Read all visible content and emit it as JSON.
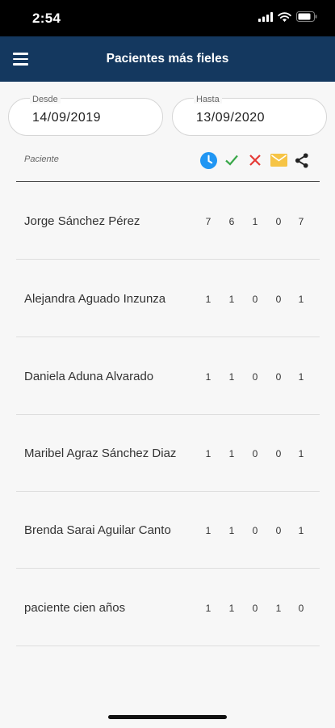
{
  "status_bar": {
    "time": "2:54"
  },
  "app_bar": {
    "title": "Pacientes más fieles"
  },
  "filters": {
    "desde": {
      "label": "Desde",
      "value": "14/09/2019"
    },
    "hasta": {
      "label": "Hasta",
      "value": "13/09/2020"
    }
  },
  "table": {
    "column_label": "Paciente",
    "icons": [
      "clock-icon",
      "check-icon",
      "cross-icon",
      "mail-icon",
      "share-icon"
    ],
    "colors": {
      "clock": "#2196f3",
      "check": "#3aa84a",
      "cross": "#e53935",
      "mail": "#f6c445",
      "share": "#222222"
    },
    "rows": [
      {
        "name": "Jorge Sánchez Pérez",
        "values": [
          "7",
          "6",
          "1",
          "0",
          "7"
        ]
      },
      {
        "name": "Alejandra Aguado Inzunza",
        "values": [
          "1",
          "1",
          "0",
          "0",
          "1"
        ]
      },
      {
        "name": "Daniela Aduna Alvarado",
        "values": [
          "1",
          "1",
          "0",
          "0",
          "1"
        ]
      },
      {
        "name": "Maribel Agraz Sánchez Diaz",
        "values": [
          "1",
          "1",
          "0",
          "0",
          "1"
        ]
      },
      {
        "name": "Brenda Sarai Aguilar Canto",
        "values": [
          "1",
          "1",
          "0",
          "0",
          "1"
        ]
      },
      {
        "name": "paciente cien años",
        "values": [
          "1",
          "1",
          "0",
          "1",
          "0"
        ]
      }
    ]
  }
}
